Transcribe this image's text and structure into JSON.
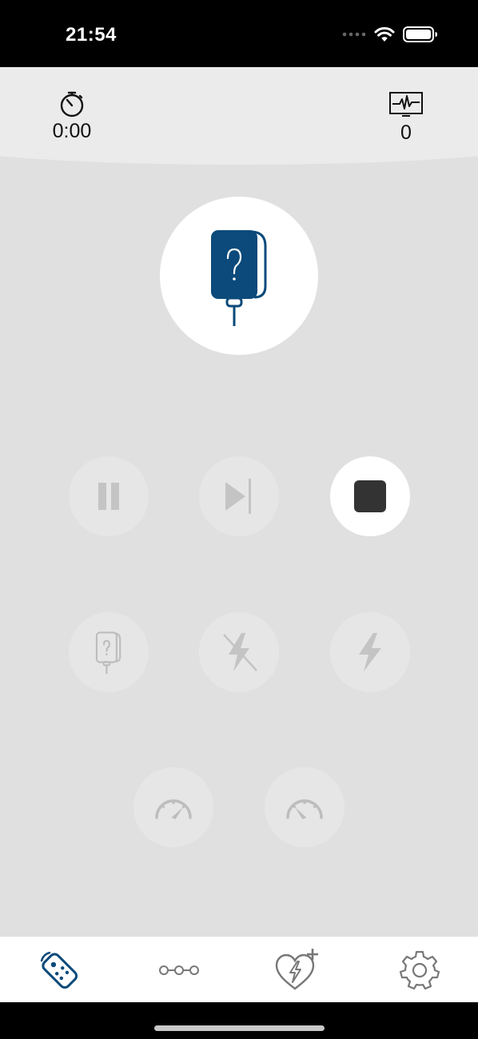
{
  "status_bar": {
    "time": "21:54",
    "icons": [
      "signal-dots-icon",
      "wifi-icon",
      "battery-icon"
    ]
  },
  "header": {
    "timer": {
      "icon": "stopwatch-icon",
      "value": "0:00"
    },
    "shock_counter": {
      "icon": "ecg-monitor-icon",
      "value": "0"
    }
  },
  "hero": {
    "icon": "electrode-pad-unknown-icon",
    "color": "#0b4a7a"
  },
  "controls": {
    "row1": [
      {
        "name": "pause-button",
        "icon": "pause-icon",
        "enabled": false
      },
      {
        "name": "skip-button",
        "icon": "skip-forward-icon",
        "enabled": false
      },
      {
        "name": "stop-button",
        "icon": "stop-icon",
        "enabled": true
      }
    ],
    "row2": [
      {
        "name": "pad-check-button",
        "icon": "electrode-pad-unknown-icon",
        "enabled": false
      },
      {
        "name": "no-shock-button",
        "icon": "no-shock-icon",
        "enabled": false
      },
      {
        "name": "shock-button",
        "icon": "lightning-bolt-icon",
        "enabled": false
      }
    ],
    "row3": [
      {
        "name": "speed-low-button",
        "icon": "gauge-low-icon",
        "enabled": false
      },
      {
        "name": "speed-high-button",
        "icon": "gauge-high-icon",
        "enabled": false
      }
    ]
  },
  "tab_bar": {
    "tabs": [
      {
        "name": "tab-remote",
        "icon": "remote-control-icon",
        "selected": true
      },
      {
        "name": "tab-scenarios",
        "icon": "connected-nodes-icon",
        "selected": false
      },
      {
        "name": "tab-aed",
        "icon": "heart-shock-plus-icon",
        "selected": false
      },
      {
        "name": "tab-settings",
        "icon": "gear-icon",
        "selected": false
      }
    ]
  },
  "colors": {
    "accent": "#0b4a7a",
    "disabled_icon": "#bdbdbd",
    "background": "#e0e0e0",
    "header_band": "#ebebeb",
    "stop_icon": "#333333"
  }
}
